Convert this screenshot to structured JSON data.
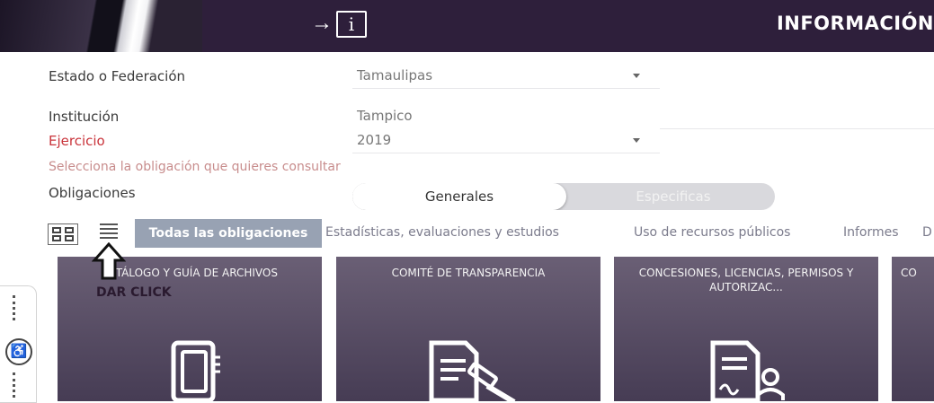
{
  "header": {
    "icon": "exit-info-icon",
    "title": "INFORMACIÓN"
  },
  "form": {
    "estado_label": "Estado o Federación",
    "estado_value": "Tamaulipas",
    "institucion_label": "Institución",
    "institucion_value": "Tampico",
    "ejercicio_label": "Ejercicio",
    "ejercicio_value": "2019",
    "hint": "Selecciona la obligación que quieres consultar",
    "obligaciones_label": "Obligaciones",
    "toggle": {
      "generales": "Generales",
      "especificas": "Especificas"
    }
  },
  "view": {
    "grid_icon": "grid-view-icon",
    "list_icon": "list-view-icon",
    "active_tab": "Todas las obligaciones",
    "tabs": [
      "Estadísticas, evaluaciones y estudios",
      "Uso de recursos públicos",
      "Informes",
      "D"
    ]
  },
  "annotation": {
    "text": "DAR CLICK"
  },
  "cards": [
    {
      "title": "CATÁLOGO Y GUÍA DE ARCHIVOS",
      "icon": "binder-icon"
    },
    {
      "title": "COMITÉ DE TRANSPARENCIA",
      "icon": "document-gavel-icon"
    },
    {
      "title": "CONCESIONES, LICENCIAS, PERMISOS Y AUTORIZAC...",
      "icon": "document-person-icon"
    },
    {
      "title": "CO",
      "icon": ""
    }
  ],
  "colors": {
    "header_bg": "#2e1f3b",
    "card_bg": "#564b63",
    "active_tab_bg": "#98a2b3",
    "label_red": "#c9333a"
  }
}
